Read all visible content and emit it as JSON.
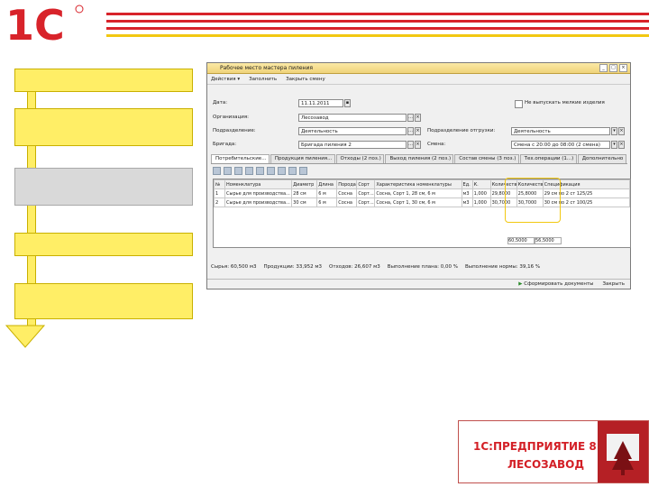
{
  "brand": {
    "logo_text": "1С"
  },
  "window": {
    "title": "Рабочее место мастера пиления",
    "menu": [
      "Действия ▾",
      "Заполнить",
      "Закрыть смену"
    ],
    "fields": {
      "date_label": "Дата:",
      "date_value": "11.11.2011",
      "org_label": "Организация:",
      "org_value": "Лесозавод",
      "division_label": "Подразделение:",
      "division_value": "Деятельность",
      "brigade_label": "Бригада:",
      "brigade_value": "Бригада пиления 2",
      "sawmill_label": "Подразделение отгрузки:",
      "sawmill_value": "Деятельность",
      "shift_label": "Смена:",
      "shift_value": "Смена с 20:00 до 08:00 (2 смена)",
      "checkbox_label": "Не выпускать мелкие изделия"
    },
    "tabs": [
      "Потребительские...",
      "Продукция пиления...",
      "Отходы (2 поз.)",
      "Выход пиления (2 поз.)",
      "Состав смены (3 поз.)",
      "Тех.операции (1...)",
      "Дополнительно"
    ],
    "table": {
      "headers": [
        "№",
        "Номенклатура",
        "Диаметр",
        "Длина",
        "Порода",
        "Сорт",
        "Характеристика номенклатуры",
        "Ед.",
        "К.",
        "Количество План",
        "Количество Факт",
        "Спецификация"
      ],
      "rows": [
        [
          "1",
          "Сырье для производства...",
          "28 см",
          "6 м",
          "Сосна",
          "Сорт...",
          "Сосна, Сорт 1, 28 см, 6 м",
          "м3",
          "1,000",
          "29,8000",
          "25,8000",
          "29 см по 2 ст 125/25"
        ],
        [
          "2",
          "Сырье для производства...",
          "30 см",
          "6 м",
          "Сосна",
          "Сорт...",
          "Сосна, Сорт 1, 30 см, 6 м",
          "м3",
          "1,000",
          "30,7000",
          "30,7000",
          "30 см по 2 ст 100/25"
        ]
      ],
      "footer_plan": "60,5000",
      "footer_fact": "56,5000"
    },
    "totals": [
      "Сырья: 60,500 м3",
      "Продукции: 33,952 м3",
      "Отходов: 26,607 м3",
      "Выполнение плана: 0,00 %",
      "Выполнение нормы: 39,16 %"
    ],
    "status": {
      "action": "Сформировать документы",
      "close": "Закрыть"
    }
  },
  "product": {
    "line1": "1С:ПРЕДПРИЯТИЕ 8",
    "line2": "ЛЕСОЗАВОД"
  },
  "colors": {
    "yellow": "#ffee66",
    "red": "#d8232a",
    "grey": "#d9d9d9"
  }
}
